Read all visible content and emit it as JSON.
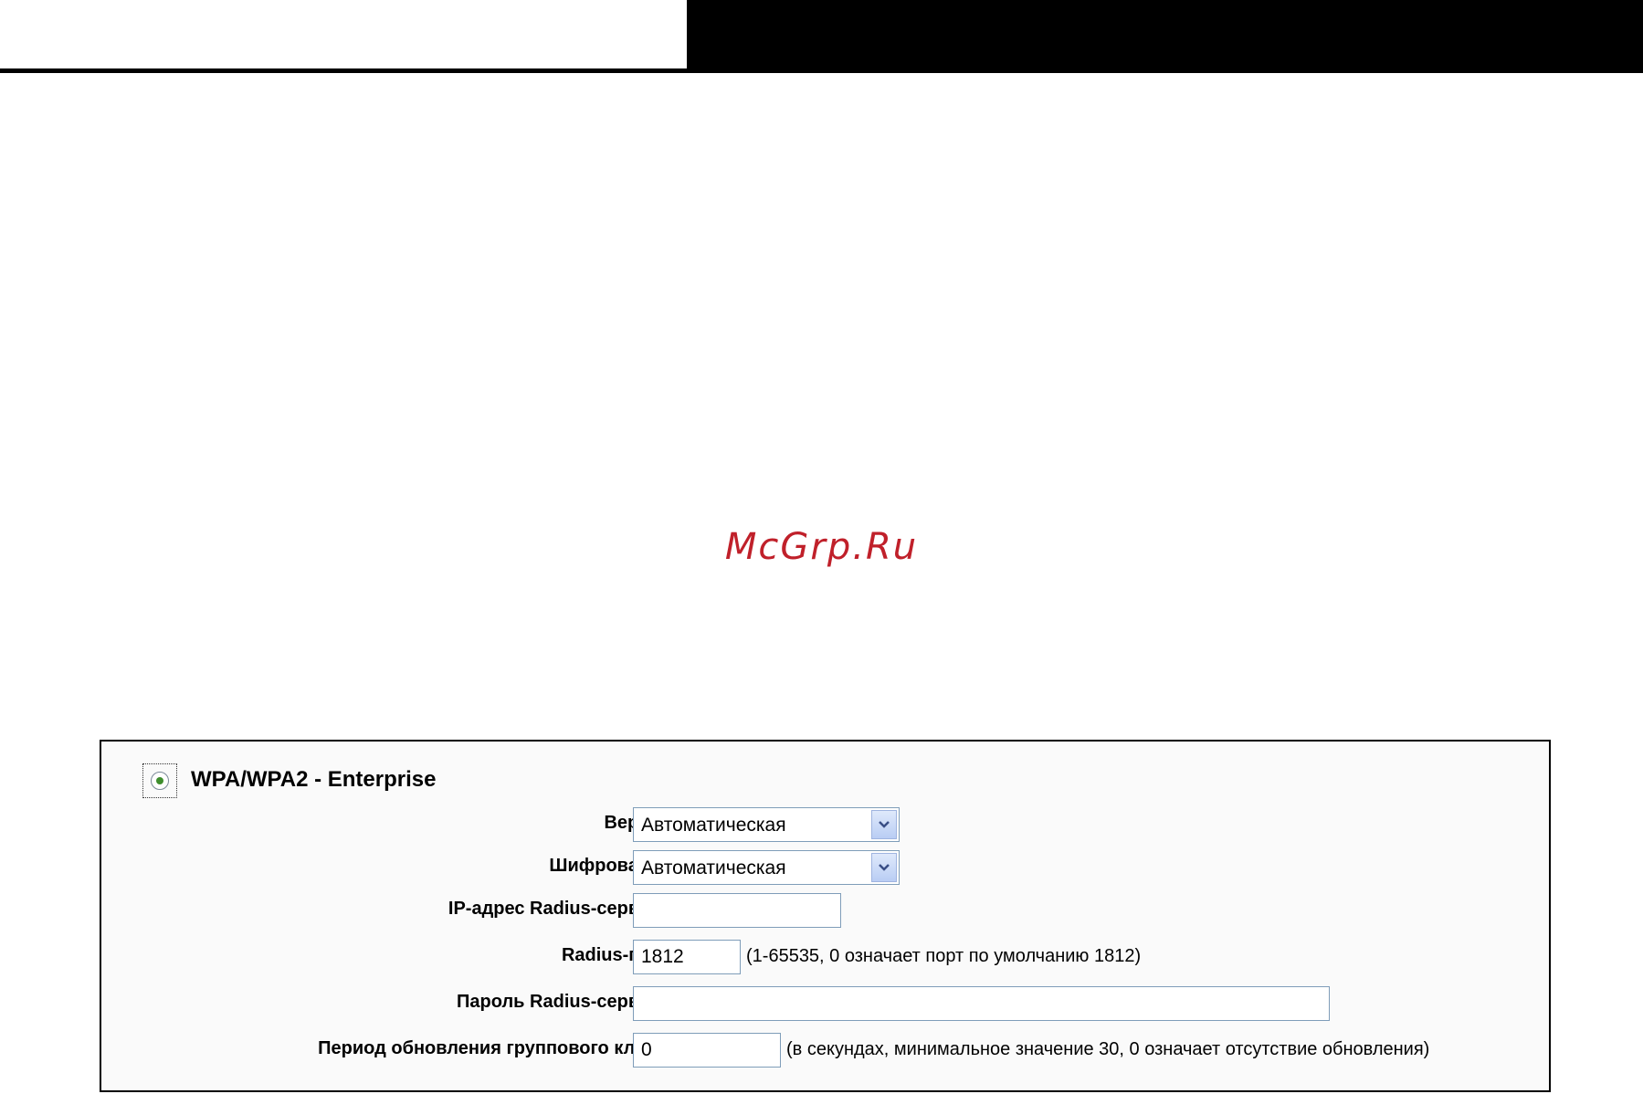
{
  "watermark": "McGrp.Ru",
  "security": {
    "mode_label": "WPA/WPA2 - Enterprise",
    "version": {
      "label": "Версия:",
      "value": "Автоматическая"
    },
    "encryption": {
      "label": "Шифрование:",
      "value": "Автоматическая"
    },
    "radius_ip": {
      "label": "IP-адрес Radius-сервера:",
      "value": ""
    },
    "radius_port": {
      "label": "Radius-порт:",
      "value": "1812",
      "hint": "(1-65535, 0 означает порт по умолчанию 1812)"
    },
    "radius_password": {
      "label": "Пароль Radius-сервера:",
      "value": ""
    },
    "group_key_period": {
      "label": "Период обновления группового ключа:",
      "value": "0",
      "hint": "(в секундах, минимальное значение 30, 0 означает отсутствие обновления)"
    }
  }
}
